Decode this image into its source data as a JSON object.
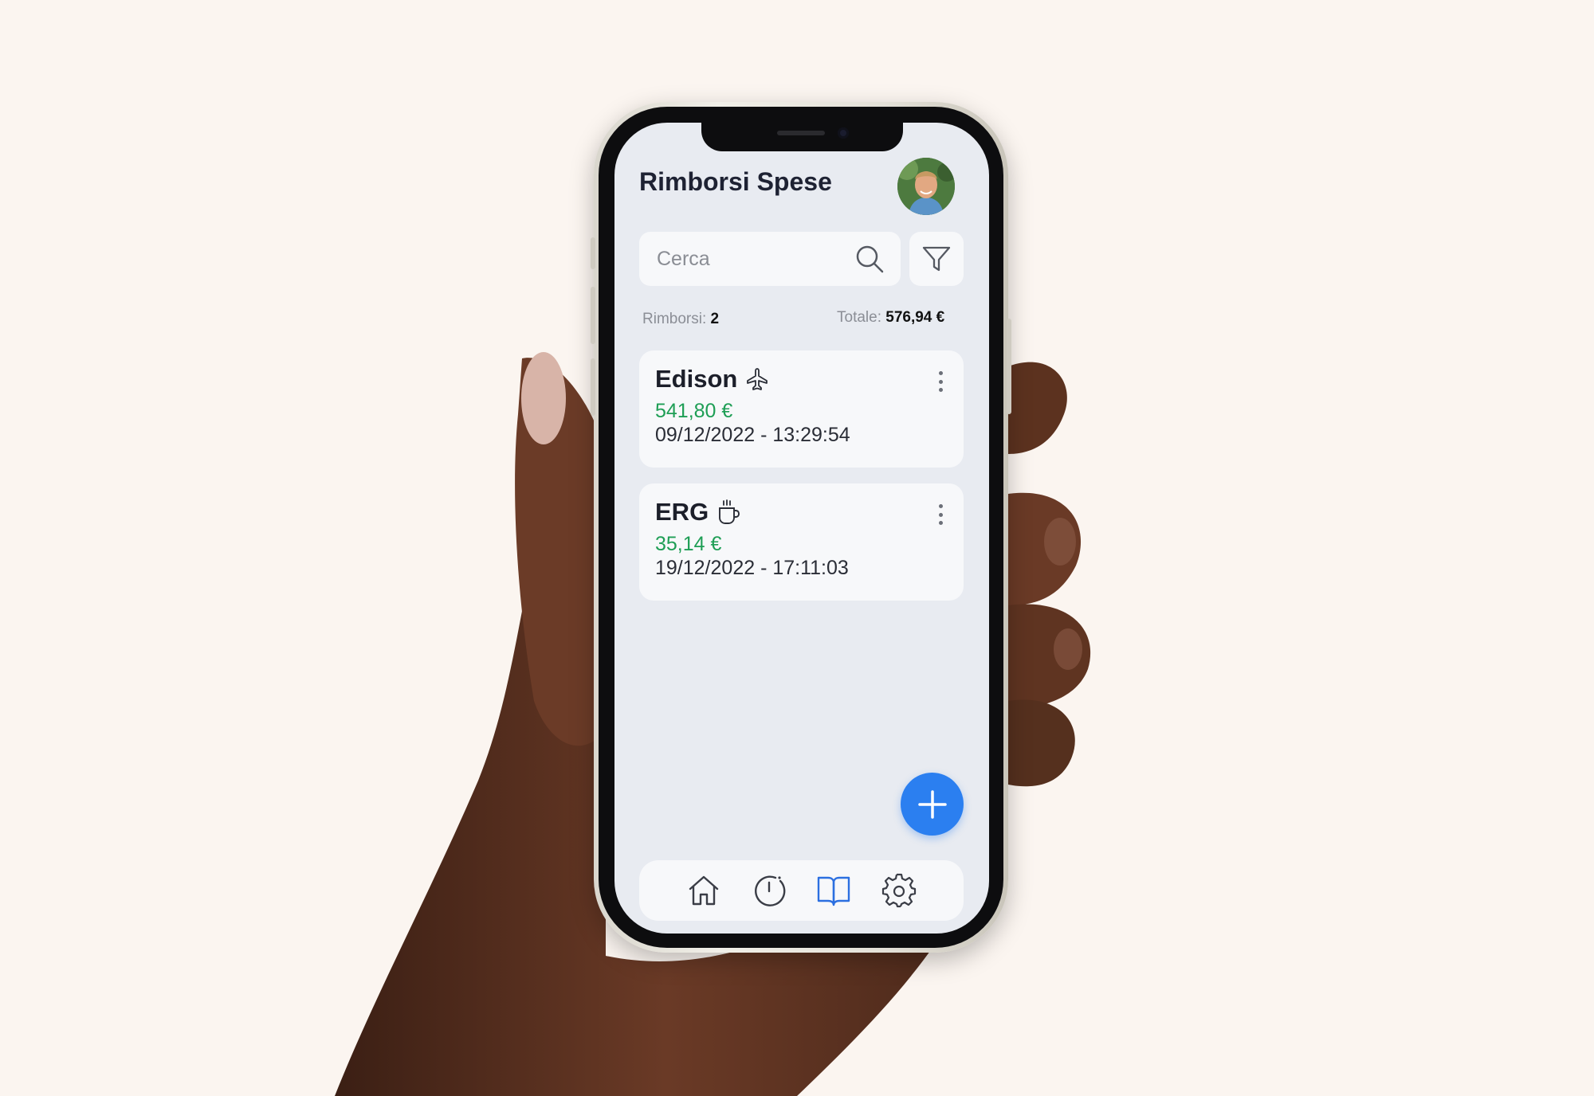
{
  "app": {
    "title": "Rimborsi Spese"
  },
  "search": {
    "placeholder": "Cerca"
  },
  "summary": {
    "count_label": "Rimborsi:",
    "count_value": "2",
    "total_label": "Totale:",
    "total_value": "576,94 €"
  },
  "expenses": [
    {
      "name": "Edison",
      "category_icon": "airplane-icon",
      "amount": "541,80 €",
      "datetime": "09/12/2022 - 13:29:54"
    },
    {
      "name": "ERG",
      "category_icon": "coffee-cup-icon",
      "amount": "35,14 €",
      "datetime": "19/12/2022 - 17:11:03"
    }
  ],
  "nav": {
    "items": [
      {
        "icon": "home-icon",
        "active": false
      },
      {
        "icon": "clock-icon",
        "active": false
      },
      {
        "icon": "book-icon",
        "active": true
      },
      {
        "icon": "gear-icon",
        "active": false
      }
    ]
  },
  "colors": {
    "background": "#fbf5f0",
    "screen": "#e8ebf1",
    "card": "#f7f8fa",
    "amount": "#1e9e55",
    "accent": "#2b7ff0",
    "nav_active": "#2b6fe0",
    "nav_inactive": "#3a3d46"
  }
}
